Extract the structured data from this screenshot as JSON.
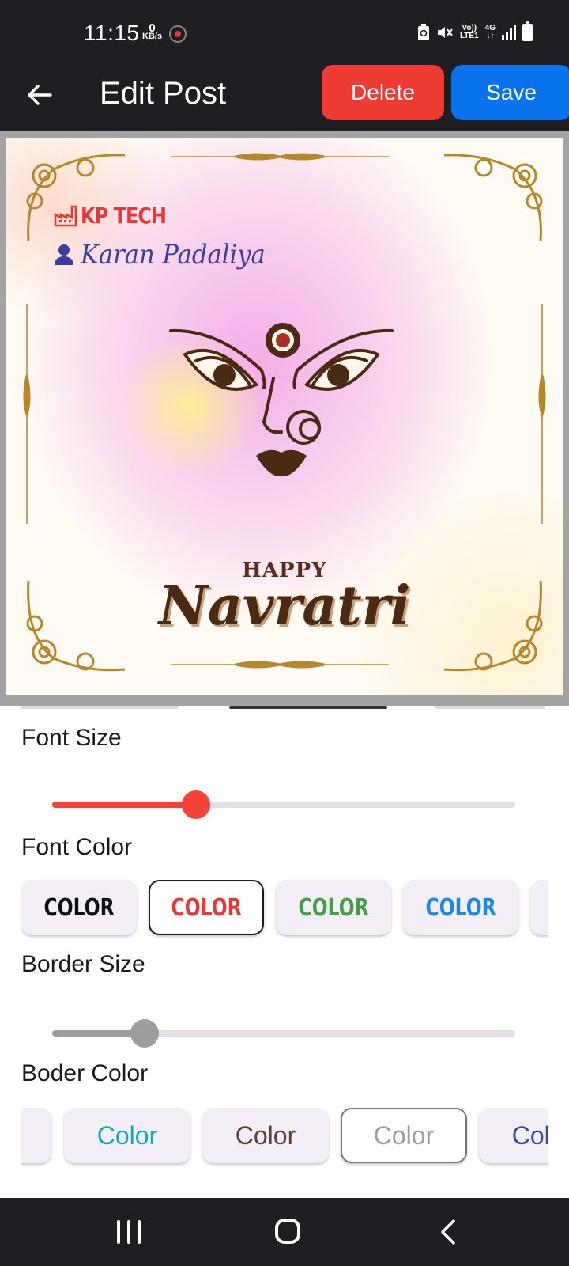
{
  "status_bar": {
    "time": "11:15",
    "speed_value": "0",
    "speed_unit": "KB/s",
    "volte": "Vo))",
    "lte": "LTE1",
    "net_type": "4G"
  },
  "app_bar": {
    "title": "Edit Post",
    "delete_label": "Delete",
    "save_label": "Save"
  },
  "post": {
    "brand": "KP TECH",
    "person": "Karan Padaliya",
    "greeting_small": "HAPPY",
    "greeting_large": "Navratri",
    "colors": {
      "brand": "#e53935",
      "person": "#3a3f9e",
      "greeting": "#4a2a12",
      "ornament": "#b8862b"
    }
  },
  "editor": {
    "font_size_label": "Font Size",
    "font_size_value": 0.31,
    "font_color_label": "Font Color",
    "font_colors": [
      {
        "label": "COLOR",
        "color": "#111111",
        "selected": false
      },
      {
        "label": "COLOR",
        "color": "#e53935",
        "selected": true
      },
      {
        "label": "COLOR",
        "color": "#43a047",
        "selected": false
      },
      {
        "label": "COLOR",
        "color": "#1e88e5",
        "selected": false
      }
    ],
    "border_size_label": "Border Size",
    "border_size_value": 0.2,
    "border_color_label": "Boder Color",
    "border_colors": [
      {
        "label": "Color",
        "color": "#1aa6b7",
        "selected": false
      },
      {
        "label": "Color",
        "color": "#5d4037",
        "selected": false
      },
      {
        "label": "Color",
        "color": "#9e9e9e",
        "selected": true
      },
      {
        "label": "Color",
        "color": "#3949ab",
        "selected": false
      }
    ],
    "slider_colors": {
      "font": "#f44336",
      "border": "#9e9e9e"
    }
  }
}
